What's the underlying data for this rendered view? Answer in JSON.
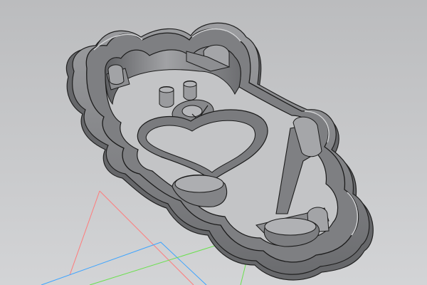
{
  "viewport": {
    "background_top": "#bbbcbe",
    "background_bottom": "#d3d4d6"
  },
  "model": {
    "shape": "bear-shaped-cookie-cutter",
    "fill_color": "#8e8f92",
    "shadow_color": "#5b5c5f",
    "edge_color": "#262626",
    "highlight_color": "#b7b8ba"
  },
  "axes": {
    "x_color": "#3da4ff",
    "y_color": "#6be04f",
    "z_color": "#ff7b7b"
  }
}
